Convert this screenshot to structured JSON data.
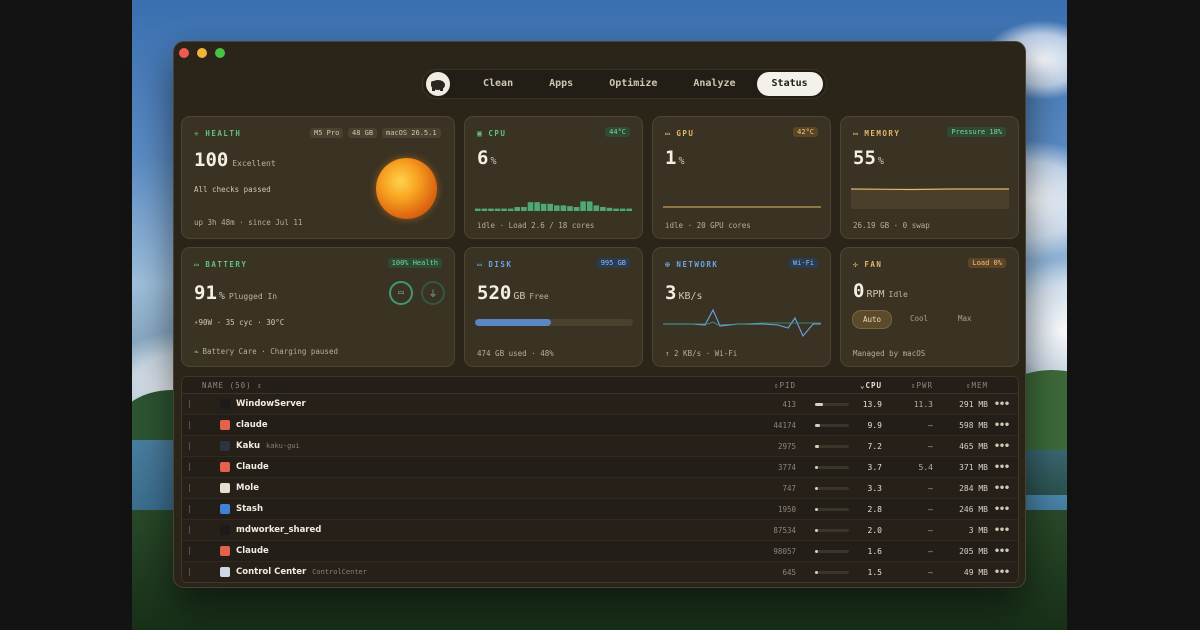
{
  "nav": {
    "tabs": [
      {
        "label": "Clean"
      },
      {
        "label": "Apps"
      },
      {
        "label": "Optimize"
      },
      {
        "label": "Analyze"
      },
      {
        "label": "Status",
        "active": true
      }
    ]
  },
  "health": {
    "title": "HEALTH",
    "chips": [
      "M5 Pro",
      "48 GB",
      "macOS 26.5.1"
    ],
    "score": "100",
    "score_label": "Excellent",
    "status": "All checks passed",
    "uptime": "up 3h 48m · since Jul 11"
  },
  "cpu": {
    "title": "CPU",
    "temp": "44°C",
    "value": "6",
    "unit": "%",
    "footer": "idle · Load 2.6 / 18 cores",
    "history_percent": [
      3,
      3,
      3,
      3,
      3,
      3,
      5,
      5,
      11,
      11,
      9,
      9,
      7,
      7,
      6,
      5,
      12,
      12,
      7,
      5,
      4,
      3,
      3,
      3
    ]
  },
  "gpu": {
    "title": "GPU",
    "temp": "42°C",
    "value": "1",
    "unit": "%",
    "footer": "idle · 20 GPU cores"
  },
  "memory": {
    "title": "MEMORY",
    "chip": "Pressure 18%",
    "value": "55",
    "unit": "%",
    "footer": "26.19 GB · 0 swap"
  },
  "battery": {
    "title": "BATTERY",
    "chip": "100% Health",
    "value": "91",
    "unit": "%",
    "state": "Plugged In",
    "details": "⚡90W · 35 cyc · 30°C",
    "care": "Battery Care · Charging paused"
  },
  "disk": {
    "title": "DISK",
    "chip": "995 GB",
    "value": "520",
    "unit": "GB",
    "state": "Free",
    "used_fraction": 0.48,
    "footer": "474 GB used · 48%"
  },
  "network": {
    "title": "NETWORK",
    "chip": "Wi-Fi",
    "value": "3",
    "unit": "KB/s",
    "footer": "↑ 2 KB/s · Wi-Fi"
  },
  "fan": {
    "title": "FAN",
    "chip": "Load 0%",
    "value": "0",
    "unit": "RPM",
    "state": "Idle",
    "modes": [
      "Auto",
      "Cool",
      "Max"
    ],
    "footer": "Managed by macOS"
  },
  "table": {
    "columns": {
      "name": "NAME (50)",
      "pid": "PID",
      "cpu": "CPU",
      "pwr": "PWR",
      "mem": "MEM"
    },
    "rows": [
      {
        "name": "WindowServer",
        "sub": "",
        "pid": "413",
        "cpu": "13.9",
        "cpu_pct": 0.139,
        "pwr": "11.3",
        "mem": "291 MB",
        "icon": "#1b1b1b"
      },
      {
        "name": "claude",
        "sub": "",
        "pid": "44174",
        "cpu": "9.9",
        "cpu_pct": 0.099,
        "pwr": "—",
        "mem": "598 MB",
        "icon": "#e2624a"
      },
      {
        "name": "Kaku",
        "sub": "kaku-gui",
        "pid": "2975",
        "cpu": "7.2",
        "cpu_pct": 0.072,
        "pwr": "—",
        "mem": "465 MB",
        "icon": "#2a3540"
      },
      {
        "name": "Claude",
        "sub": "",
        "pid": "3774",
        "cpu": "3.7",
        "cpu_pct": 0.037,
        "pwr": "5.4",
        "mem": "371 MB",
        "icon": "#e2624a"
      },
      {
        "name": "Mole",
        "sub": "",
        "pid": "747",
        "cpu": "3.3",
        "cpu_pct": 0.033,
        "pwr": "—",
        "mem": "284 MB",
        "icon": "#e7dfcf"
      },
      {
        "name": "Stash",
        "sub": "",
        "pid": "1950",
        "cpu": "2.8",
        "cpu_pct": 0.028,
        "pwr": "—",
        "mem": "246 MB",
        "icon": "#3f82d6"
      },
      {
        "name": "mdworker_shared",
        "sub": "",
        "pid": "87534",
        "cpu": "2.0",
        "cpu_pct": 0.02,
        "pwr": "—",
        "mem": "3 MB",
        "icon": "#1b1b1b"
      },
      {
        "name": "Claude",
        "sub": "",
        "pid": "98057",
        "cpu": "1.6",
        "cpu_pct": 0.016,
        "pwr": "—",
        "mem": "205 MB",
        "icon": "#e2624a"
      },
      {
        "name": "Control Center",
        "sub": "ControlCenter",
        "pid": "645",
        "cpu": "1.5",
        "cpu_pct": 0.015,
        "pwr": "—",
        "mem": "49 MB",
        "icon": "#cfd9e6"
      }
    ]
  },
  "colors": {
    "green": "#5fc08a",
    "amber": "#e3b76b",
    "blue": "#6aa6e6",
    "orange": "#e0873a"
  }
}
